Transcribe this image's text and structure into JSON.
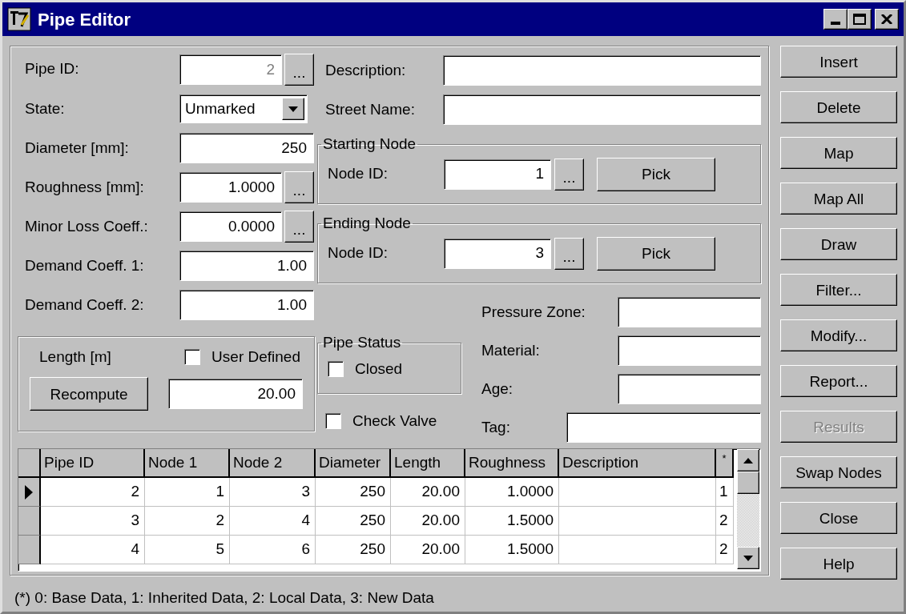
{
  "window": {
    "title": "Pipe Editor"
  },
  "left_fields": [
    {
      "label": "Pipe ID:",
      "kind": "text",
      "value": "2",
      "disabled": true,
      "browse_label": "..."
    },
    {
      "label": "State:",
      "kind": "dropdown",
      "value": "Unmarked",
      "disabled": false
    },
    {
      "label": "Diameter [mm]:",
      "kind": "text",
      "value": "250",
      "disabled": false
    },
    {
      "label": "Roughness [mm]:",
      "kind": "text",
      "value": "1.0000",
      "disabled": false,
      "browse_label": "..."
    },
    {
      "label": "Minor Loss Coeff.:",
      "kind": "text",
      "value": "0.0000",
      "disabled": false,
      "browse_label": "..."
    },
    {
      "label": "Demand Coeff. 1:",
      "kind": "text",
      "value": "1.00",
      "disabled": false
    },
    {
      "label": "Demand Coeff. 2:",
      "kind": "text",
      "value": "1.00",
      "disabled": false
    }
  ],
  "top_fields": [
    {
      "label": "Description:"
    },
    {
      "label": "Street Name:"
    }
  ],
  "node_groups": [
    {
      "title": "Starting Node",
      "label": "Node ID:",
      "value": "1",
      "browse_label": "...",
      "pick": {
        "label": "Pick"
      }
    },
    {
      "title": "Ending Node",
      "label": "Node ID:",
      "value": "3",
      "browse_label": "...",
      "pick": {
        "label": "Pick"
      }
    }
  ],
  "length_group": {
    "label": "Length [m]",
    "user_defined": {
      "label": "User Defined",
      "checked": false
    },
    "recompute": {
      "label": "Recompute"
    },
    "value": "20.00"
  },
  "pipe_status": {
    "title": "Pipe Status",
    "closed": {
      "label": "Closed",
      "checked": false
    }
  },
  "check_valve": {
    "label": "Check Valve",
    "checked": false
  },
  "attributes": [
    {
      "label": "Pressure Zone:"
    },
    {
      "label": "Material:"
    },
    {
      "label": "Age:"
    },
    {
      "label": "Tag:"
    }
  ],
  "table": {
    "columns": [
      "Pipe ID",
      "Node 1",
      "Node 2",
      "Diameter",
      "Length",
      "Roughness",
      "Description",
      "*"
    ],
    "rows": [
      {
        "current": true,
        "cells": [
          "2",
          "1",
          "3",
          "250",
          "20.00",
          "1.0000",
          "",
          "1"
        ]
      },
      {
        "current": false,
        "cells": [
          "3",
          "2",
          "4",
          "250",
          "20.00",
          "1.5000",
          "",
          "2"
        ]
      },
      {
        "current": false,
        "cells": [
          "4",
          "5",
          "6",
          "250",
          "20.00",
          "1.5000",
          "",
          "2"
        ]
      }
    ]
  },
  "buttons": [
    {
      "label": "Insert",
      "disabled": false
    },
    {
      "label": "Delete",
      "disabled": false
    },
    {
      "label": "Map",
      "disabled": false
    },
    {
      "label": "Map All",
      "disabled": false
    },
    {
      "label": "Draw",
      "disabled": false
    },
    {
      "label": "Filter...",
      "disabled": false
    },
    {
      "label": "Modify...",
      "disabled": false
    },
    {
      "label": "Report...",
      "disabled": false
    },
    {
      "label": "Results",
      "disabled": true
    },
    {
      "label": "Swap Nodes",
      "disabled": false
    },
    {
      "label": "Close",
      "disabled": false
    },
    {
      "label": "Help",
      "disabled": false
    }
  ],
  "status_text": "(*) 0: Base Data, 1: Inherited Data, 2: Local Data, 3: New Data"
}
